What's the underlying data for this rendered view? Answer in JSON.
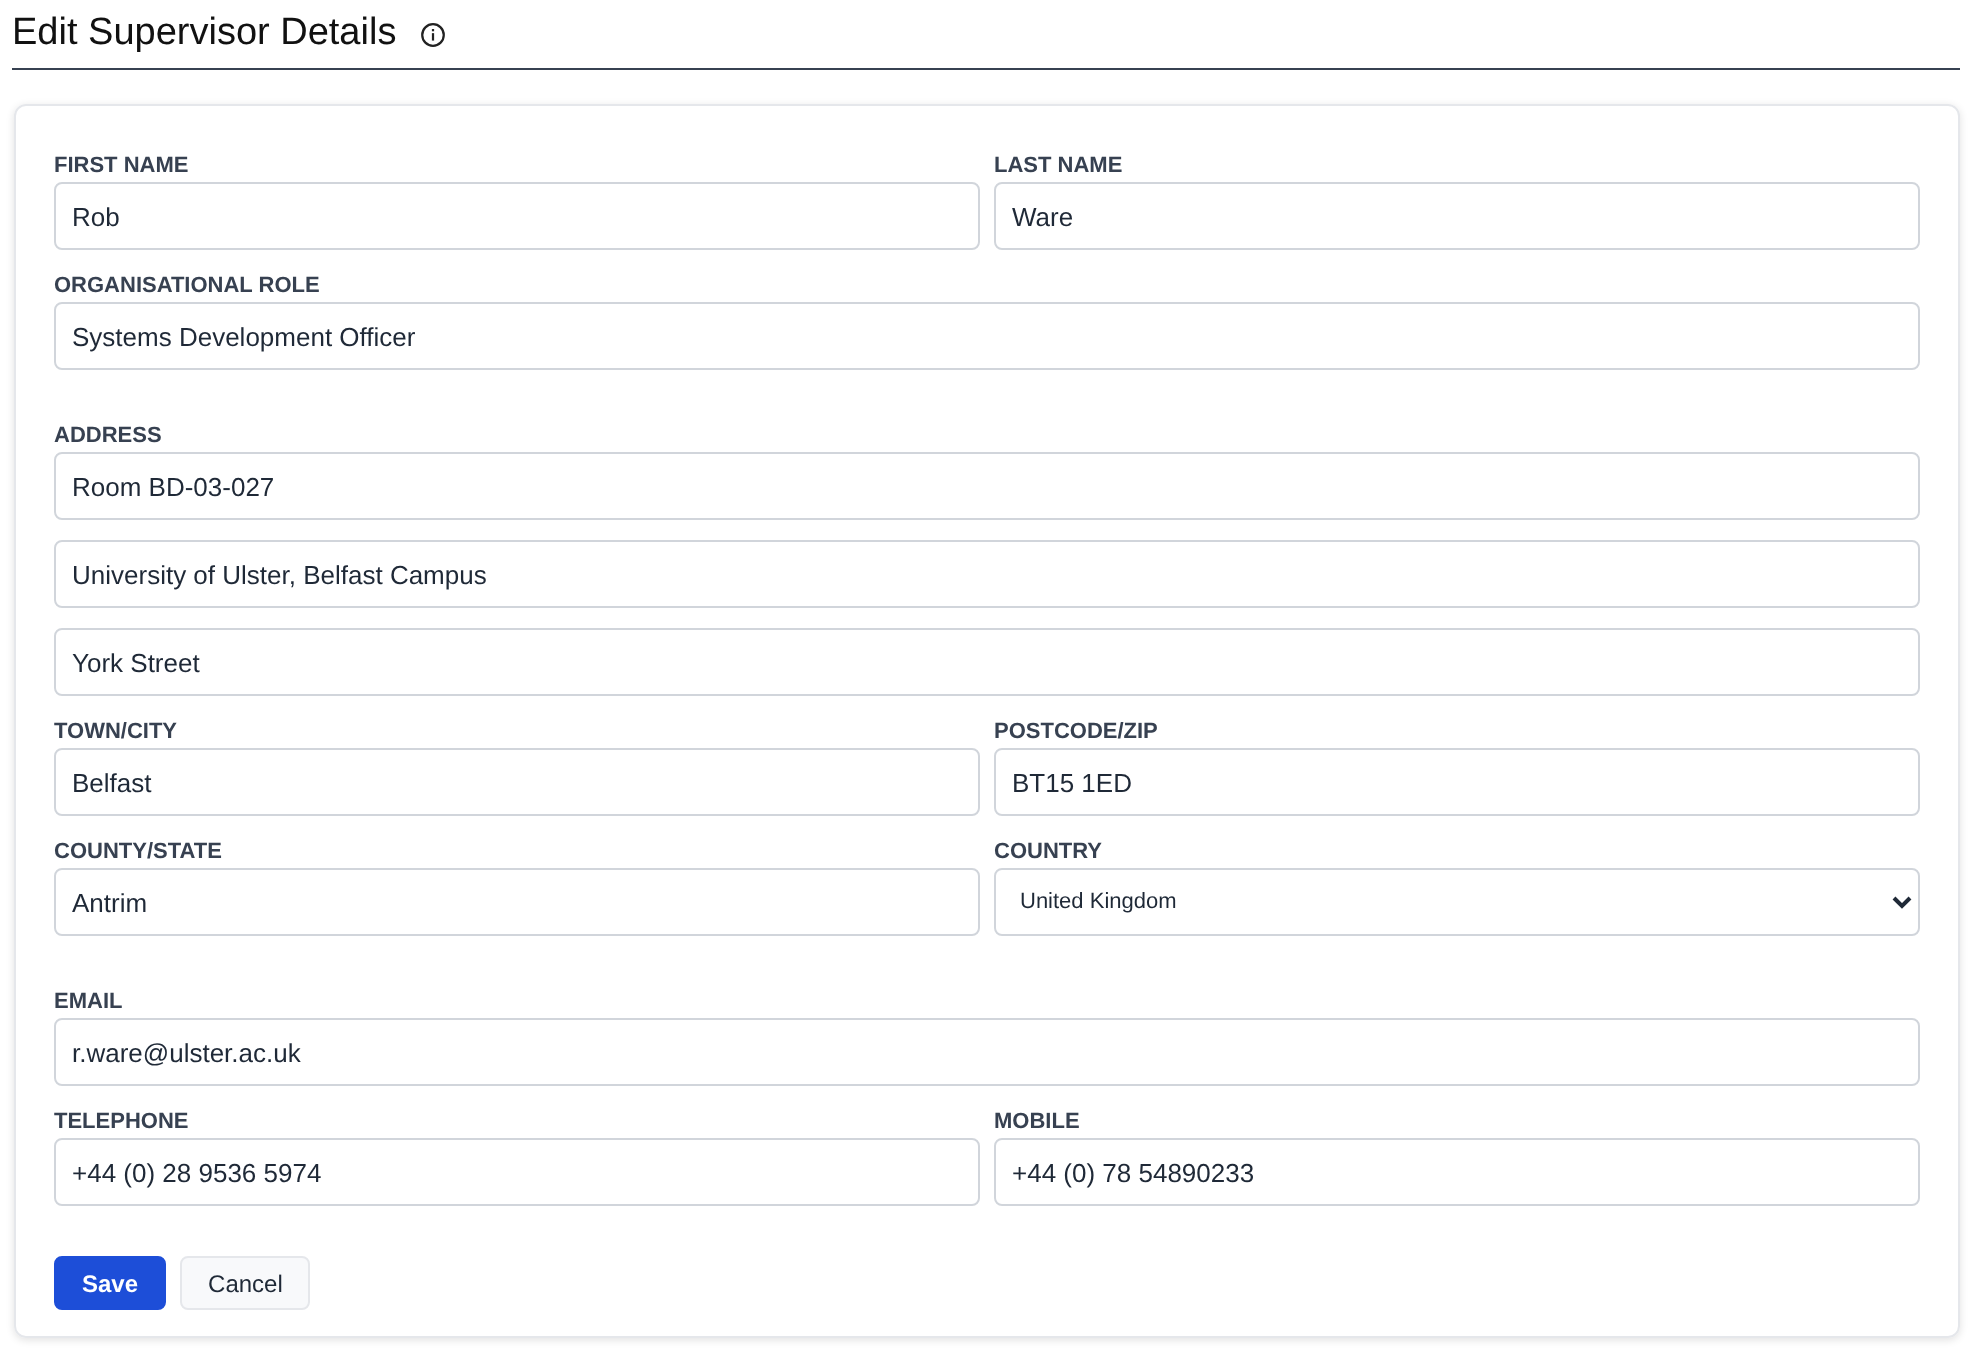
{
  "title": "Edit Supervisor Details",
  "sections": [
    {
      "rows": [
        [
          {
            "kind": "text",
            "label": "FIRST NAME",
            "value": "Rob"
          },
          {
            "kind": "text",
            "label": "LAST NAME",
            "value": "Ware"
          }
        ],
        [
          {
            "kind": "text",
            "label": "ORGANISATIONAL ROLE",
            "value": "Systems Development Officer"
          }
        ]
      ]
    },
    {
      "rows": [
        [
          {
            "kind": "text",
            "label": "ADDRESS",
            "value": "Room BD-03-027"
          }
        ],
        [
          {
            "kind": "text",
            "value": "University of Ulster, Belfast Campus"
          }
        ],
        [
          {
            "kind": "text",
            "value": "York Street"
          }
        ],
        [
          {
            "kind": "text",
            "label": "TOWN/CITY",
            "value": "Belfast"
          },
          {
            "kind": "text",
            "label": "POSTCODE/ZIP",
            "value": "BT15 1ED"
          }
        ],
        [
          {
            "kind": "text",
            "label": "COUNTY/STATE",
            "value": "Antrim"
          },
          {
            "kind": "select",
            "label": "COUNTRY",
            "value": "United Kingdom"
          }
        ]
      ]
    },
    {
      "rows": [
        [
          {
            "kind": "text",
            "label": "EMAIL",
            "value": "r.ware@ulster.ac.uk"
          }
        ],
        [
          {
            "kind": "text",
            "label": "TELEPHONE",
            "value": "+44 (0) 28 9536 5974"
          },
          {
            "kind": "text",
            "label": "MOBILE",
            "value": "+44 (0) 78 54890233"
          }
        ]
      ]
    }
  ],
  "buttons": [
    {
      "kind": "primary",
      "label": "Save"
    },
    {
      "kind": "secondary",
      "label": "Cancel"
    }
  ]
}
